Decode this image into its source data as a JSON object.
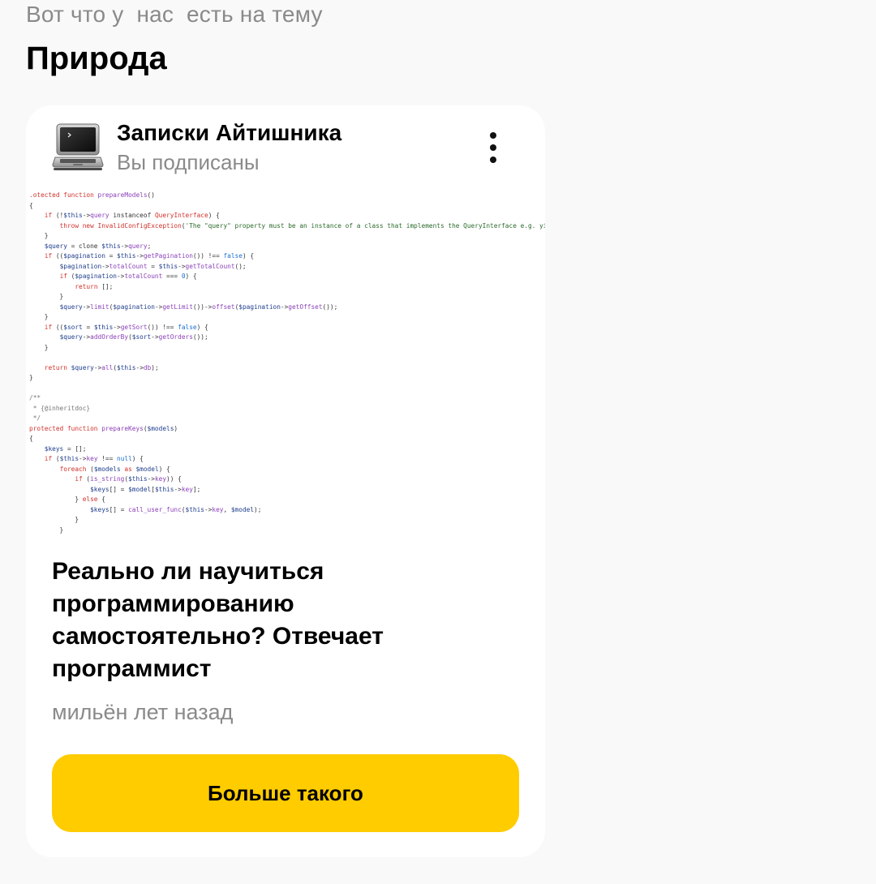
{
  "header": {
    "hint": "Вот что у  нас  есть на тему",
    "topic": "Природа"
  },
  "card": {
    "channel": {
      "name": "Записки Айтишника",
      "status": "Вы подписаны",
      "avatar_icon": "laptop-icon"
    },
    "menu_icon": "more-vertical-icon",
    "article": {
      "title": "Реально ли научиться программированию самостоятельно? Отвечает программист",
      "time": "мильён лет назад"
    },
    "action_button": "Больше такого",
    "colors": {
      "button": "#ffcc00",
      "card": "#ffffff",
      "background": "#f9f9f9"
    }
  }
}
